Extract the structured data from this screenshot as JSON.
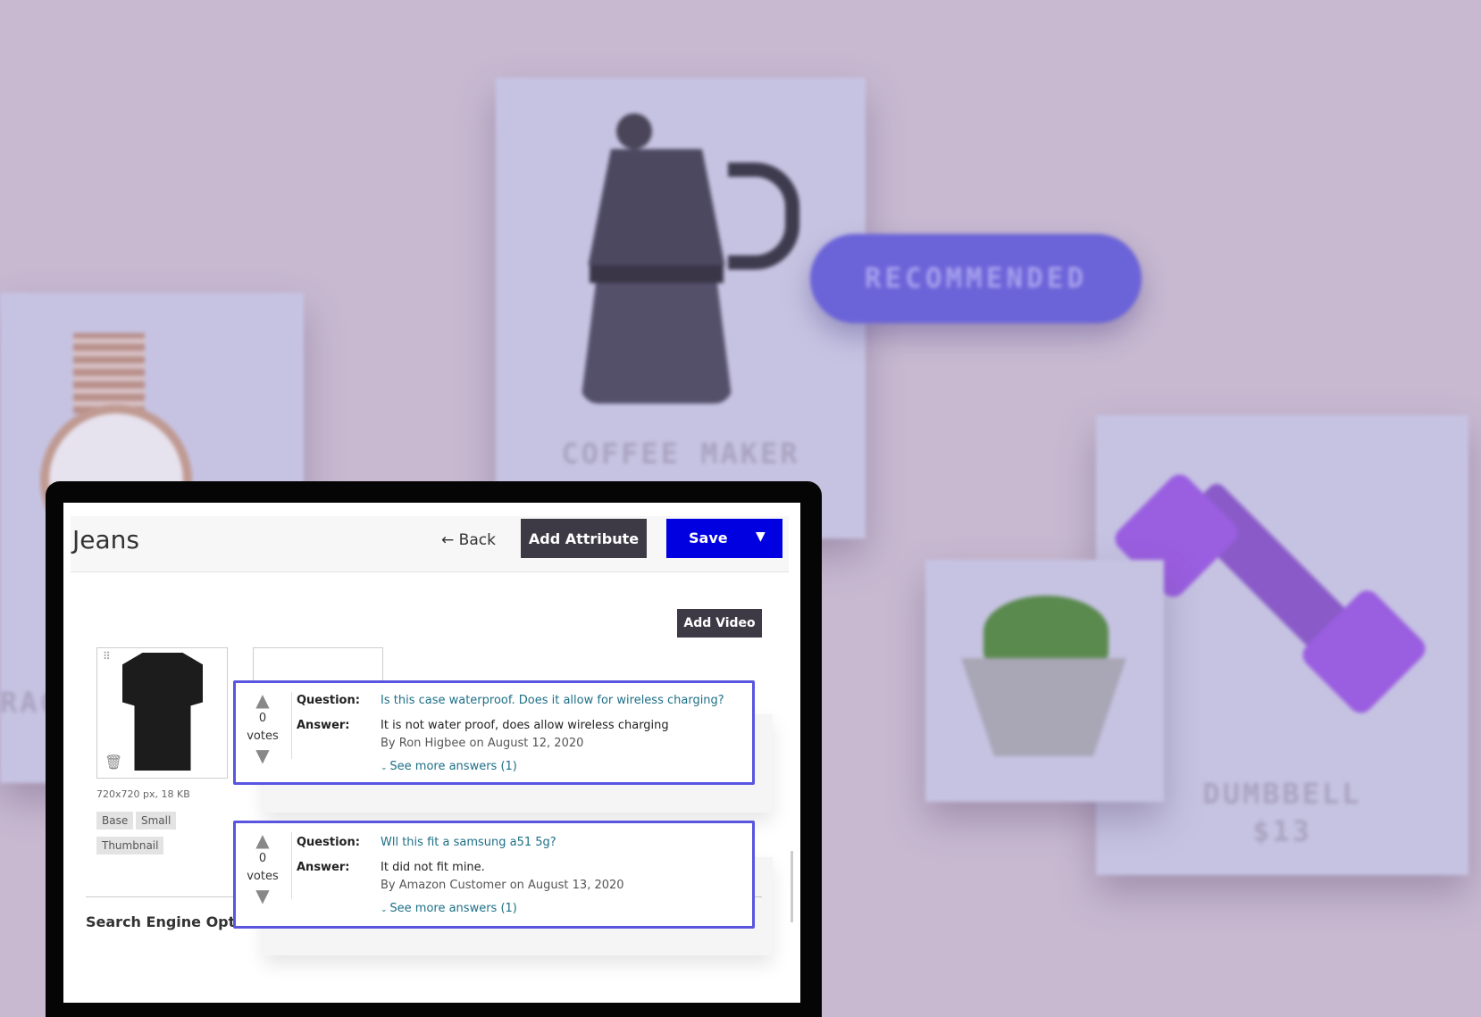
{
  "background": {
    "recommended_label": "RECOMMENDED",
    "coffee_maker_label": "COFFEE MAKER",
    "dumbbell_label": "DUMBBELL",
    "dumbbell_price": "$13",
    "partial_label": "RAC"
  },
  "colors": {
    "accent": "#5a55e0",
    "save": "#0000e0",
    "dark_button": "#3d3a45",
    "pill": "#6b63d8",
    "link": "#1d6f86"
  },
  "header": {
    "title": "Jeans",
    "back_label": "Back",
    "add_attribute_label": "Add Attribute",
    "save_label": "Save"
  },
  "media": {
    "add_video_label": "Add Video",
    "image_info": "720x720 px, 18 KB",
    "roles": [
      "Base",
      "Small",
      "Thumbnail"
    ]
  },
  "seo_heading": "Search Engine Optimization",
  "questions": [
    {
      "votes": "0",
      "votes_label": "votes",
      "question_label": "Question:",
      "question": "Is this case waterproof. Does it allow for wireless charging?",
      "answer_label": "Answer:",
      "answer": "It is not water proof, does allow wireless charging",
      "byline": "By Ron Higbee on August 12, 2020",
      "more": "See more answers (1)"
    },
    {
      "votes": "0",
      "votes_label": "votes",
      "question_label": "Question:",
      "question": "Wll this fit a samsung a51 5g?",
      "answer_label": "Answer:",
      "answer": "It did not fit mine.",
      "byline": "By Amazon Customer on August 13, 2020",
      "more": "See more answers (1)"
    }
  ]
}
